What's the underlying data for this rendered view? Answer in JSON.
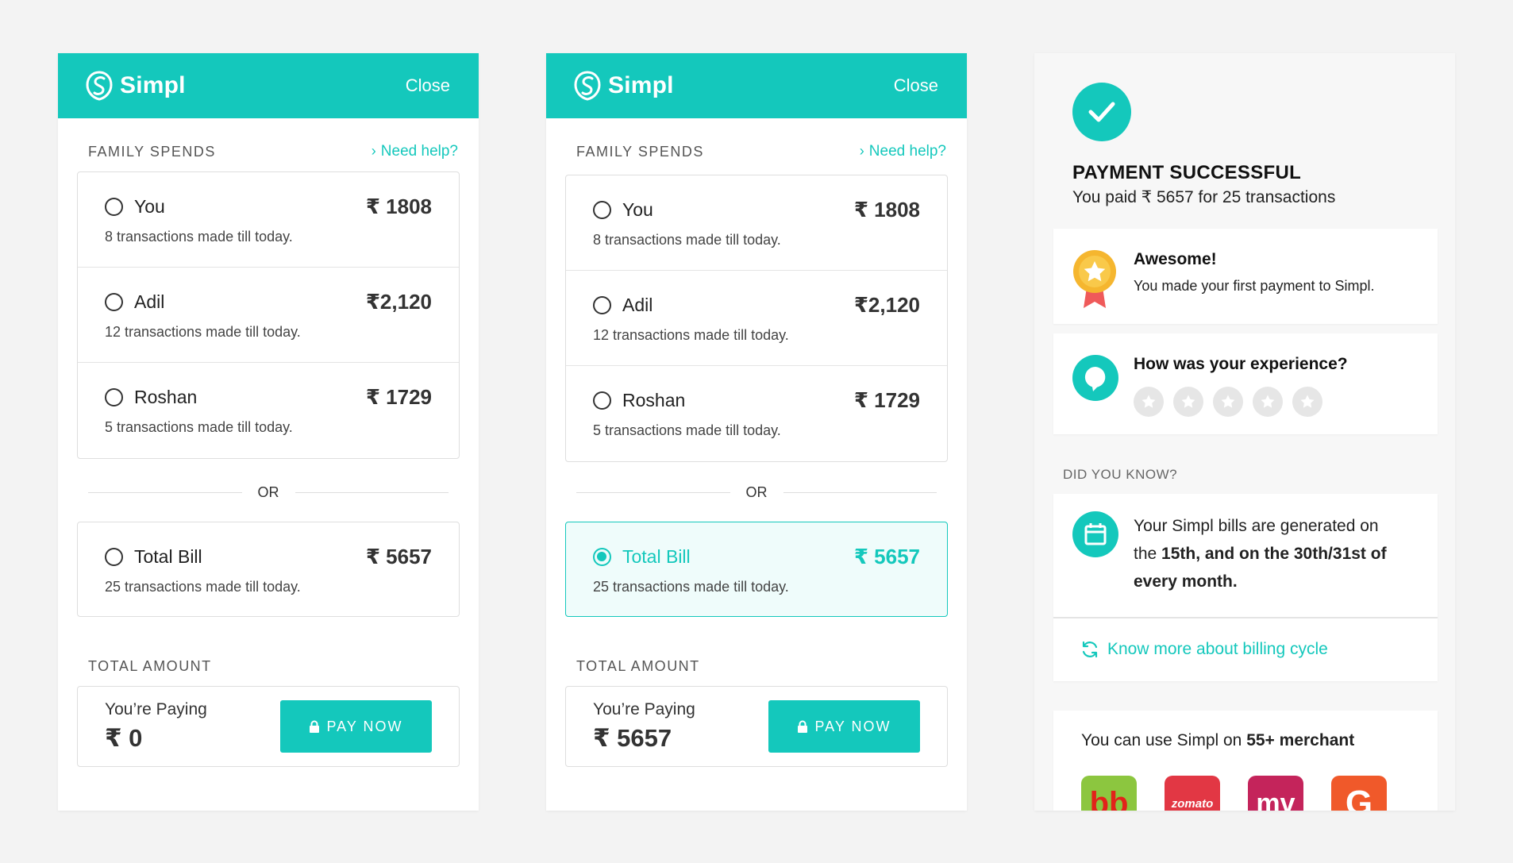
{
  "brand": {
    "name": "Simpl",
    "close_label": "Close"
  },
  "colors": {
    "accent": "#14c8bc",
    "selected_bg": "#effcfb"
  },
  "family": {
    "section_title": "FAMILY SPENDS",
    "help_label": "Need help?",
    "members": [
      {
        "name": "You",
        "amount": "₹ 1808",
        "note": "8 transactions made till today."
      },
      {
        "name": "Adil",
        "amount": "₹2,120",
        "note": "12 transactions made till today."
      },
      {
        "name": "Roshan",
        "amount": "₹ 1729",
        "note": "5 transactions made till today."
      }
    ],
    "or_label": "OR",
    "total": {
      "name": "Total Bill",
      "amount": "₹ 5657",
      "note": "25 transactions made till today."
    }
  },
  "panel_unselected": {
    "amount_title": "TOTAL AMOUNT",
    "paying_label": "You’re Paying",
    "paying_value": "₹ 0",
    "pay_button": "PAY NOW"
  },
  "panel_selected": {
    "amount_title": "TOTAL AMOUNT",
    "paying_label": "You’re Paying",
    "paying_value": "₹ 5657",
    "pay_button": "PAY NOW"
  },
  "success": {
    "title": "PAYMENT SUCCESSFUL",
    "subtitle": "You paid ₹ 5657 for 25 transactions",
    "award_title": "Awesome!",
    "award_text": "You made your first payment to Simpl.",
    "feedback_title": "How was your experience?",
    "rating_max": 5,
    "dyk_title": "DID YOU KNOW?",
    "bill_text_1": "Your Simpl bills are generated on the ",
    "bill_text_bold": "15th, and on the 30th/31st of every month.",
    "know_more": "Know more about billing cycle",
    "merchant_text": "You can use Simpl on ",
    "merchant_bold": "55+ merchant",
    "merchants": [
      {
        "name": "bb",
        "color": "#8cc63f"
      },
      {
        "name": "zomato",
        "color": "#e23744"
      },
      {
        "name": "mv",
        "color": "#c4245b"
      },
      {
        "name": "G",
        "color": "#f0592a"
      }
    ]
  }
}
